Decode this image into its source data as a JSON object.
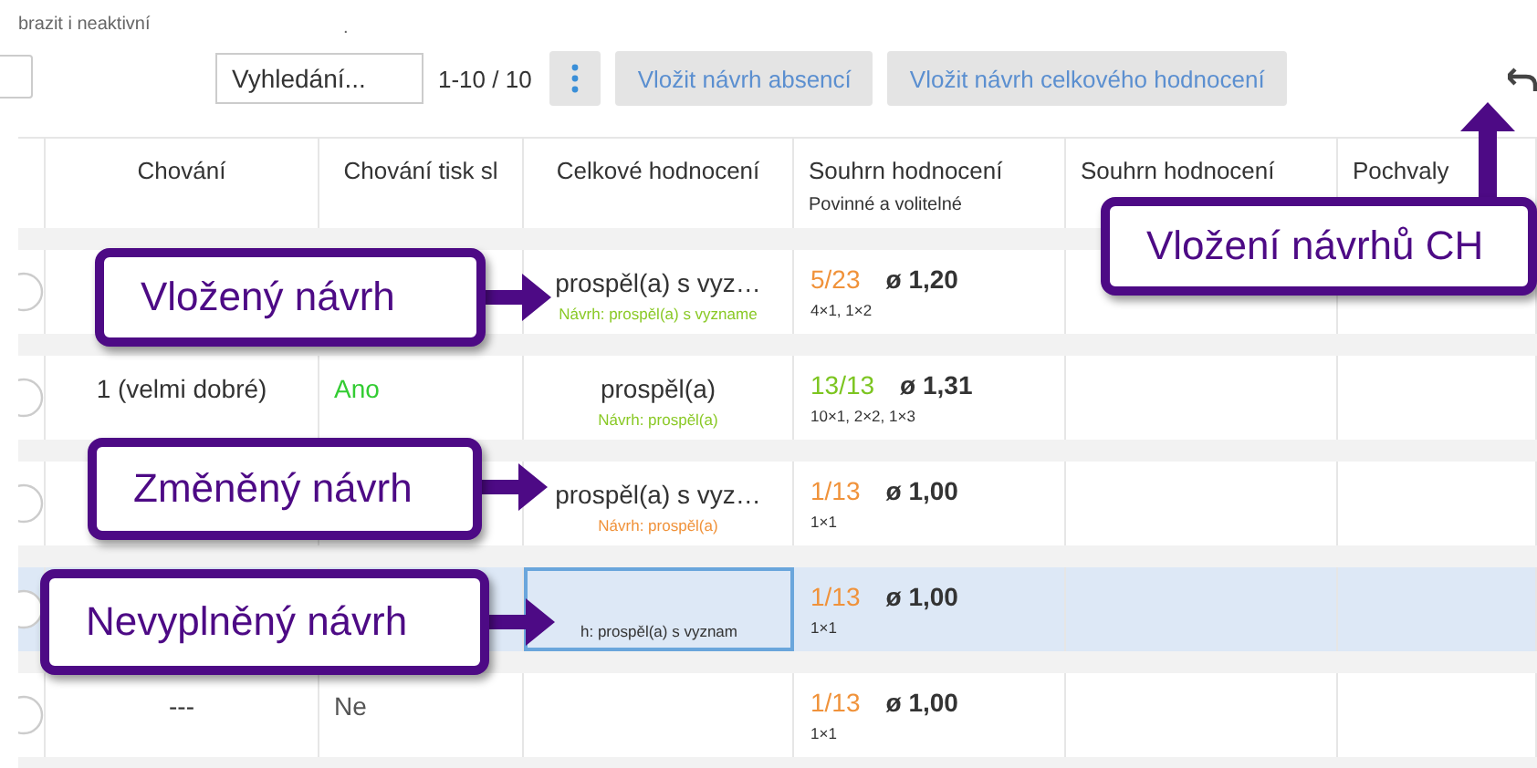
{
  "toolbar": {
    "filter_label": "brazit i neaktivní",
    "dot": ".",
    "search": {
      "placeholder": "Vyhledání..."
    },
    "paging": "1-10 / 10",
    "buttons": [
      "Vložit návrh absencí",
      "Vložit návrh celkového hodnocení"
    ]
  },
  "table": {
    "columns": [
      {},
      {
        "title": "Chování"
      },
      {
        "title": "Chování tisk sl"
      },
      {
        "title": "Celkové hodnocení"
      },
      {
        "title": "Souhrn hodnocení",
        "subtitle": "Povinné a volitelné"
      },
      {
        "title": "Souhrn hodnocení"
      },
      {
        "title": "Pochvaly"
      }
    ],
    "rows": [
      {
        "selected": false,
        "celkove": "prospěl(a) s vyz…",
        "hint": {
          "text": "Návrh: prospěl(a) s vyzname",
          "kind": "inserted"
        },
        "count": {
          "text": "5/23",
          "kind": "partial"
        },
        "avg": "ø 1,20",
        "breakdown": "4×1, 1×2"
      },
      {
        "selected": false,
        "chovani": "1 (velmi dobré)",
        "tisk": {
          "text": "Ano",
          "kind": "yes"
        },
        "celkove": "prospěl(a)",
        "hint": {
          "text": "Návrh: prospěl(a)",
          "kind": "inserted"
        },
        "count": {
          "text": "13/13",
          "kind": "complete"
        },
        "avg": "ø 1,31",
        "breakdown": "10×1, 2×2, 1×3"
      },
      {
        "selected": false,
        "celkove": "prospěl(a) s vyz…",
        "hint": {
          "text": "Návrh: prospěl(a)",
          "kind": "changed"
        },
        "count": {
          "text": "1/13",
          "kind": "partial"
        },
        "avg": "ø 1,00",
        "breakdown": "1×1"
      },
      {
        "selected": true,
        "hint": {
          "text": "h: prospěl(a) s vyznam",
          "kind": "empty"
        },
        "count": {
          "text": "1/13",
          "kind": "partial"
        },
        "avg": "ø 1,00",
        "breakdown": "1×1"
      },
      {
        "selected": false,
        "chovani": "---",
        "tisk": {
          "text": "Ne",
          "kind": "no"
        },
        "count": {
          "text": "1/13",
          "kind": "partial"
        },
        "avg": "ø 1,00",
        "breakdown": "1×1"
      }
    ]
  },
  "callouts": [
    {
      "text": "Vložený návrh",
      "kind": "right"
    },
    {
      "text": "Změněný návrh",
      "kind": "right"
    },
    {
      "text": "Nevyplněný návrh",
      "kind": "right"
    },
    {
      "text": "Vložení návrhů CH",
      "kind": "up"
    }
  ]
}
